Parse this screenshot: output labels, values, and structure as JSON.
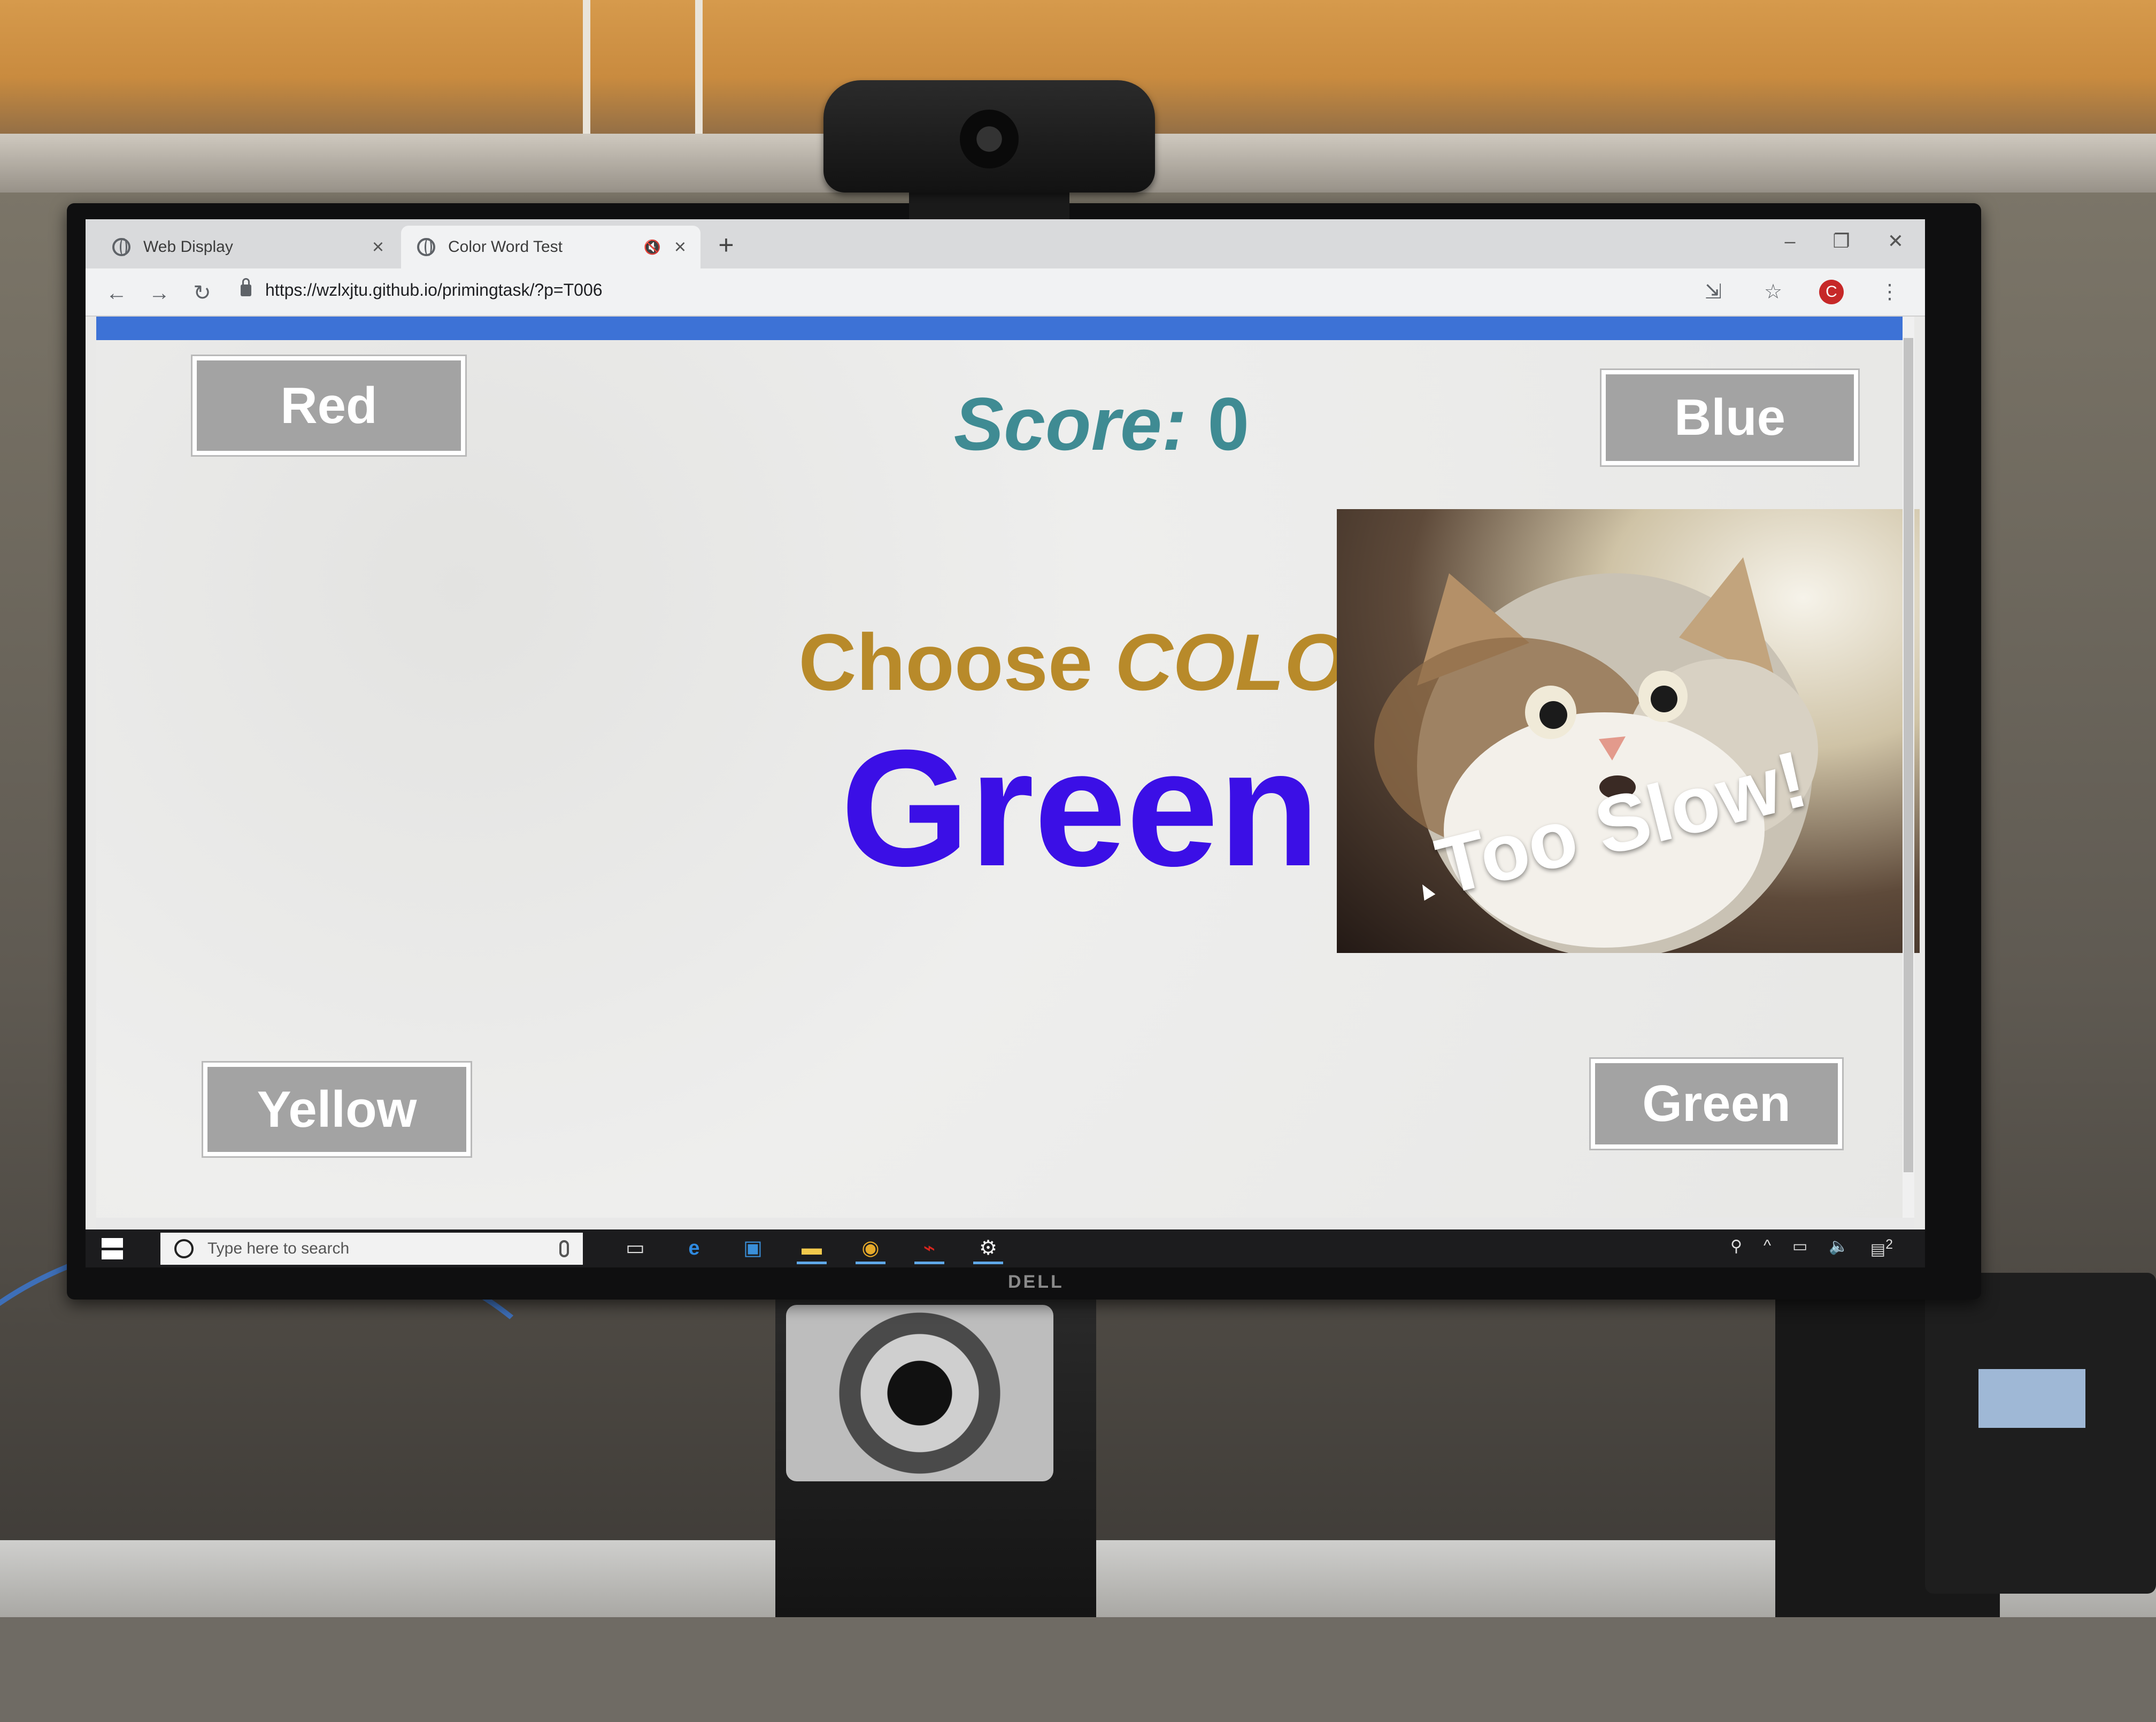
{
  "browser": {
    "tabs": [
      {
        "title": "Web Display",
        "close": "×"
      },
      {
        "title": "Color Word Test",
        "close": "×",
        "muted": true
      }
    ],
    "new_tab": "+",
    "window_controls": {
      "minimize": "–",
      "maximize": "❐",
      "close": "✕"
    },
    "nav": {
      "back": "←",
      "forward": "→",
      "reload": "↻"
    },
    "url": "https://wzlxjtu.github.io/primingtask/?p=T006",
    "profile_initial": "C",
    "toolbar_icons": [
      "extension-icon",
      "star-icon",
      "menu-icon"
    ]
  },
  "task": {
    "progress_fraction": 1.0,
    "progress_color": "#3d72d6",
    "score_label": "Score:",
    "score_value": "0",
    "instruction_prefix": "Choose",
    "instruction_emphasis": "COLOR",
    "stimulus_word": "Green",
    "stimulus_color": "#3b0fe6",
    "buttons": {
      "top_left": "Red",
      "top_right": "Blue",
      "bottom_left": "Yellow",
      "bottom_right": "Green"
    },
    "feedback_text": "Too Slow!"
  },
  "taskbar": {
    "search_placeholder": "Type here to search",
    "apps": [
      "task-view-icon",
      "edge-icon",
      "store-icon",
      "file-explorer-icon",
      "chrome-icon",
      "acrobat-icon",
      "settings-icon"
    ],
    "notification_count": "2"
  },
  "monitor_brand": "DELL"
}
